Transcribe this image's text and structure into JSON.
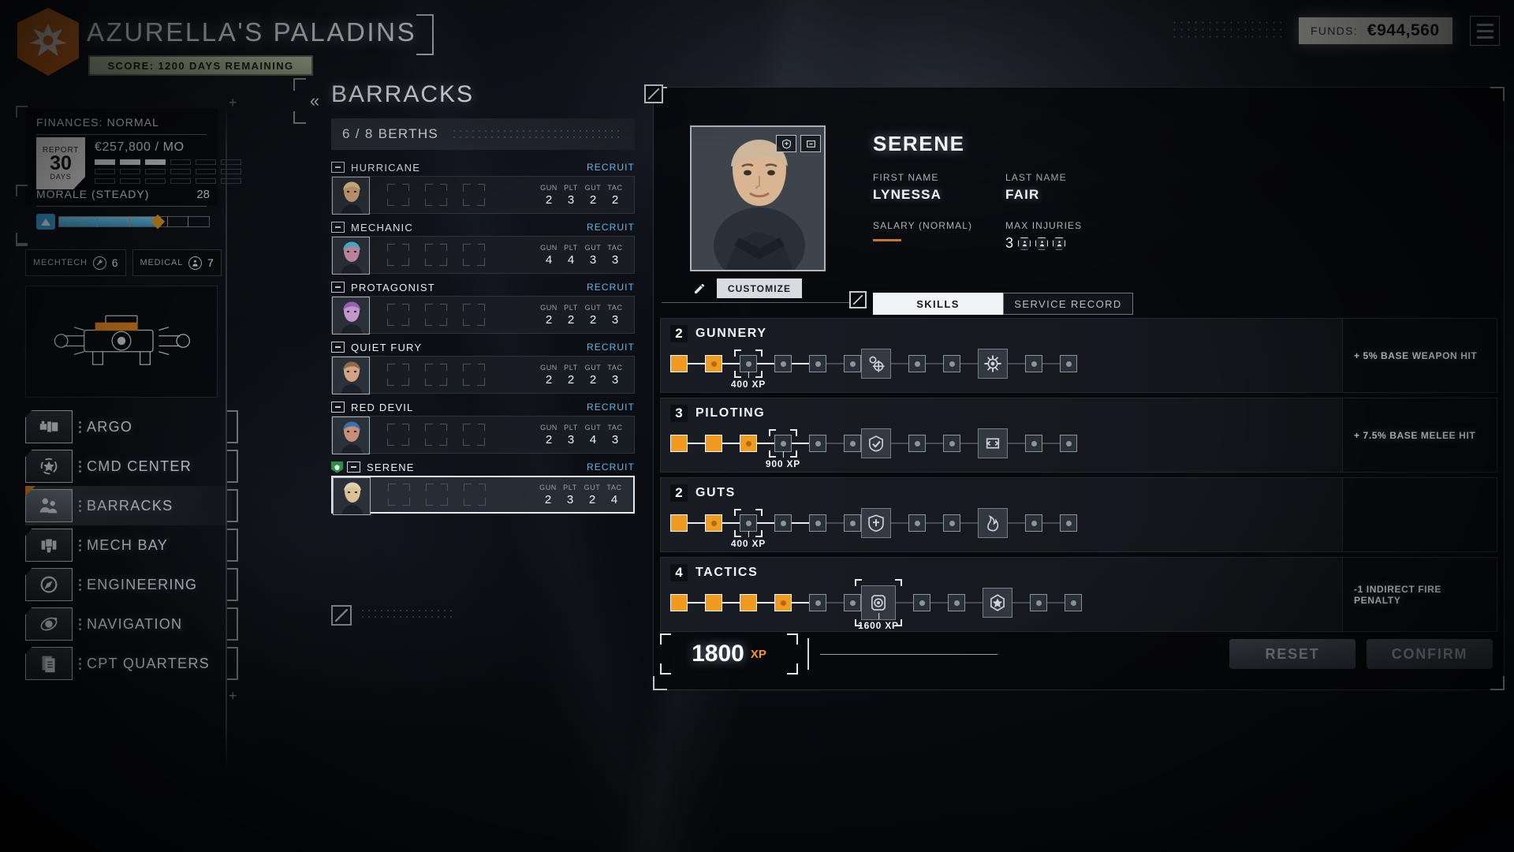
{
  "header": {
    "company_name": "AZURELLA'S PALADINS",
    "score_text": "SCORE: 1200 DAYS REMAINING",
    "funds_label": "FUNDS:",
    "funds_value": "944,560",
    "currency_symbol": "€",
    "crest_icon": "company-crest-icon",
    "menu_icon": "hamburger-menu-icon"
  },
  "sidebar": {
    "finances": {
      "title": "FINANCES: NORMAL",
      "report_top": "REPORT",
      "report_days": "30",
      "report_bottom": "DAYS",
      "amount": "€257,800 / MO"
    },
    "morale": {
      "label": "MORALE (STEADY)",
      "value": "28"
    },
    "mechtech": {
      "label": "MECHTECH",
      "value": "6",
      "icon": "wrench-icon"
    },
    "medical": {
      "label": "MEDICAL",
      "value": "7",
      "icon": "medical-icon"
    },
    "ship_icon": "argo-ship-schematic-icon",
    "nav_items": [
      {
        "label": "ARGO",
        "icon": "argo-icon",
        "active": false
      },
      {
        "label": "CMD CENTER",
        "icon": "command-center-icon",
        "active": false
      },
      {
        "label": "BARRACKS",
        "icon": "barracks-people-icon",
        "active": true
      },
      {
        "label": "MECH BAY",
        "icon": "mech-bay-icon",
        "active": false
      },
      {
        "label": "ENGINEERING",
        "icon": "engineering-compass-icon",
        "active": false
      },
      {
        "label": "NAVIGATION",
        "icon": "navigation-orbit-icon",
        "active": false
      },
      {
        "label": "CPT QUARTERS",
        "icon": "captain-quarters-document-icon",
        "active": false
      }
    ]
  },
  "barracks": {
    "title": "BARRACKS",
    "back_icon": "double-chevron-left-icon",
    "berths": "6 / 8 BERTHS",
    "stat_headers": [
      "GUN",
      "PLT",
      "GUT",
      "TAC"
    ],
    "recruit_label": "RECRUIT",
    "crew": [
      {
        "name": "HURRICANE",
        "stats": [
          "2",
          "3",
          "2",
          "2"
        ],
        "selected": false
      },
      {
        "name": "MECHANIC",
        "stats": [
          "4",
          "4",
          "3",
          "3"
        ],
        "selected": false
      },
      {
        "name": "PROTAGONIST",
        "stats": [
          "2",
          "2",
          "2",
          "3"
        ],
        "selected": false
      },
      {
        "name": "QUIET FURY",
        "stats": [
          "2",
          "2",
          "2",
          "3"
        ],
        "selected": false
      },
      {
        "name": "RED DEVIL",
        "stats": [
          "2",
          "3",
          "4",
          "3"
        ],
        "selected": false
      },
      {
        "name": "SERENE",
        "stats": [
          "2",
          "3",
          "2",
          "4"
        ],
        "selected": true
      }
    ]
  },
  "pilot": {
    "callsign": "SERENE",
    "first_name_label": "FIRST NAME",
    "first_name": "LYNESSA",
    "last_name_label": "LAST NAME",
    "last_name": "FAIR",
    "salary_label": "SALARY (NORMAL)",
    "max_injuries_label": "MAX INJURIES",
    "max_injuries": "3",
    "customize_label": "CUSTOMIZE",
    "portrait_icon": "pilot-portrait",
    "edit_icon": "pencil-edit-icon",
    "tabs": [
      {
        "label": "SKILLS",
        "active": true
      },
      {
        "label": "SERVICE RECORD",
        "active": false
      }
    ],
    "skills": [
      {
        "level": "2",
        "name": "GUNNERY",
        "filled": 2,
        "next_xp": "400 XP",
        "bonus": "+ 5% BASE WEAPON HIT",
        "ability_icons": [
          "multi-target-icon",
          "called-shot-icon"
        ]
      },
      {
        "level": "3",
        "name": "PILOTING",
        "filled": 3,
        "next_xp": "900 XP",
        "bonus": "+ 7.5% BASE MELEE HIT",
        "ability_icons": [
          "juggernaut-icon",
          "evasive-move-icon"
        ]
      },
      {
        "level": "2",
        "name": "GUTS",
        "filled": 2,
        "next_xp": "400 XP",
        "bonus": "",
        "ability_icons": [
          "bulwark-icon",
          "coolant-vent-icon"
        ]
      },
      {
        "level": "4",
        "name": "TACTICS",
        "filled": 4,
        "next_xp": "1600 XP",
        "bonus": "-1 INDIRECT FIRE PENALTY",
        "ability_icons": [
          "sensor-lock-icon",
          "master-tactician-icon"
        ]
      }
    ],
    "xp_total": "1800",
    "xp_unit": "XP",
    "reset_label": "RESET",
    "confirm_label": "CONFIRM"
  },
  "colors": {
    "accent_orange": "#f09a22",
    "link_blue": "#5fb8e8",
    "morale_blue": "#39a9e2",
    "panel_dark": "#1a1e24"
  }
}
